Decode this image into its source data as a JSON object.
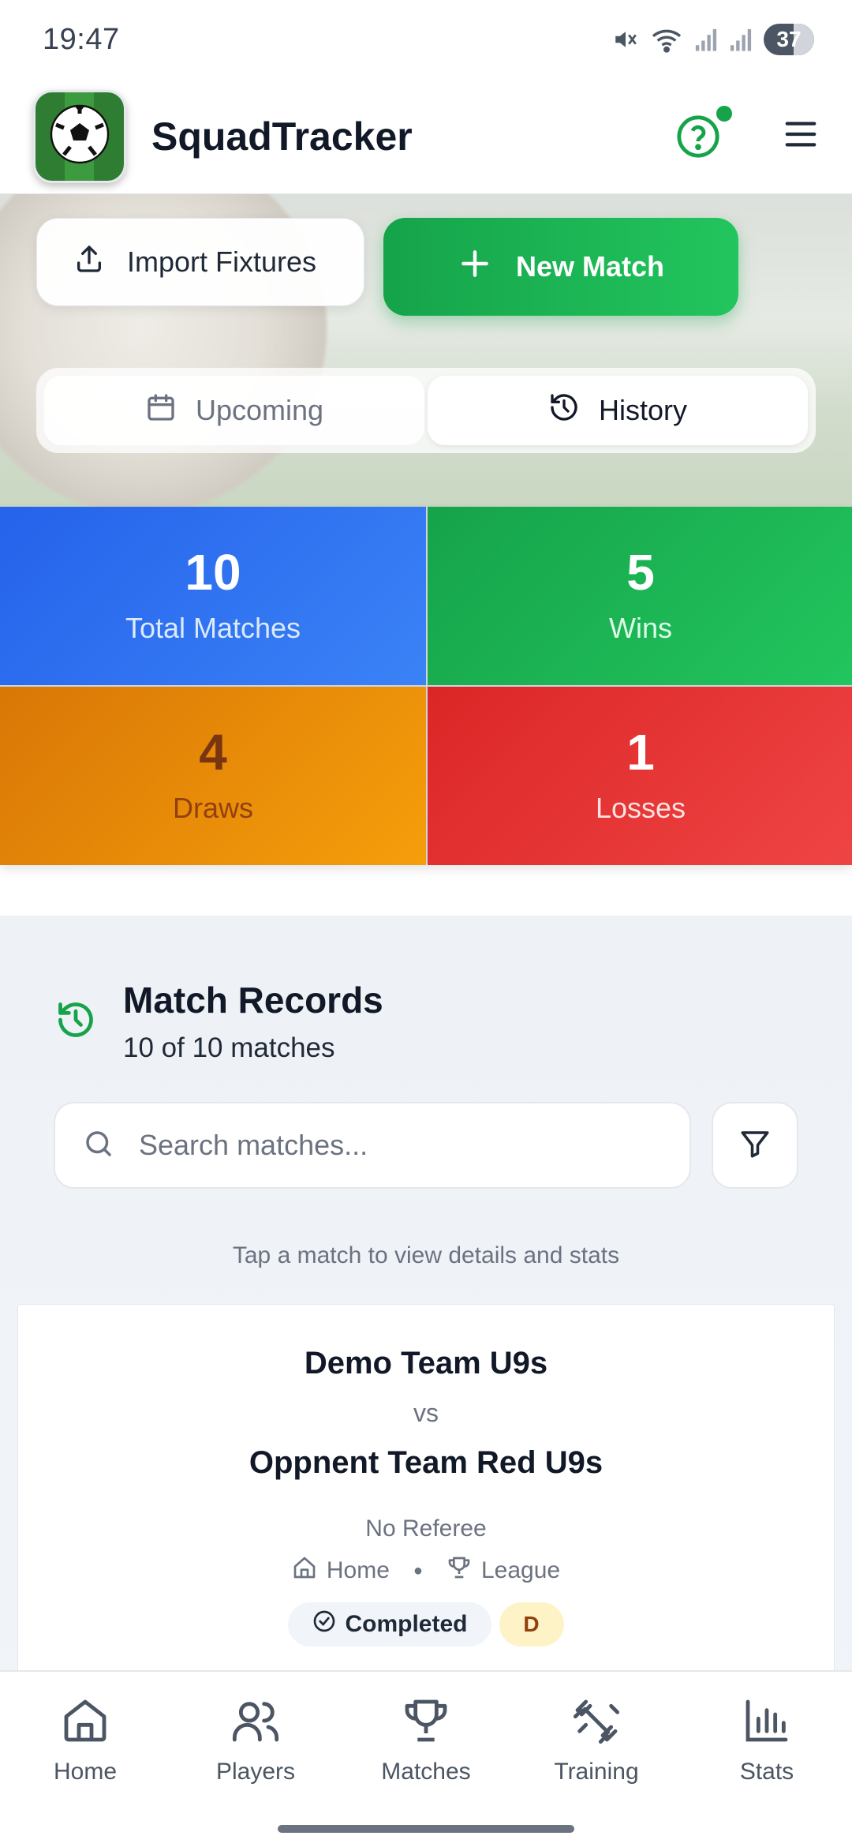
{
  "status_bar": {
    "time": "19:47",
    "battery": "37",
    "icons": [
      "mute-icon",
      "wifi-icon",
      "signal-icon",
      "signal-icon"
    ]
  },
  "header": {
    "app_name": "SquadTracker",
    "logo_icon": "soccer-ball-icon",
    "help_icon": "help-circle-icon",
    "menu_icon": "hamburger-menu-icon",
    "notification_dot_color": "#16a34a"
  },
  "actions": {
    "import_label": "Import Fixtures",
    "new_match_label": "New Match"
  },
  "view_toggle": {
    "upcoming_label": "Upcoming",
    "history_label": "History",
    "active": "history"
  },
  "stats": {
    "total": {
      "value": "10",
      "label": "Total Matches",
      "color": "#2563eb"
    },
    "wins": {
      "value": "5",
      "label": "Wins",
      "color": "#16a34a"
    },
    "draws": {
      "value": "4",
      "label": "Draws",
      "color": "#d97706"
    },
    "losses": {
      "value": "1",
      "label": "Losses",
      "color": "#dc2626"
    }
  },
  "records": {
    "title": "Match Records",
    "count_text": "10 of 10 matches",
    "search_placeholder": "Search matches...",
    "hint": "Tap a match to view details and stats"
  },
  "matches": [
    {
      "home_team": "Demo Team U9s",
      "vs": "vs",
      "away_team": "Oppnent Team Red U9s",
      "referee": "No Referee",
      "venue": "Home",
      "competition": "League",
      "status": "Completed",
      "result": "D"
    }
  ],
  "bottom_nav": {
    "items": [
      {
        "label": "Home",
        "icon": "home-icon"
      },
      {
        "label": "Players",
        "icon": "users-icon"
      },
      {
        "label": "Matches",
        "icon": "trophy-icon"
      },
      {
        "label": "Training",
        "icon": "dumbbell-icon"
      },
      {
        "label": "Stats",
        "icon": "bar-chart-icon"
      }
    ]
  }
}
